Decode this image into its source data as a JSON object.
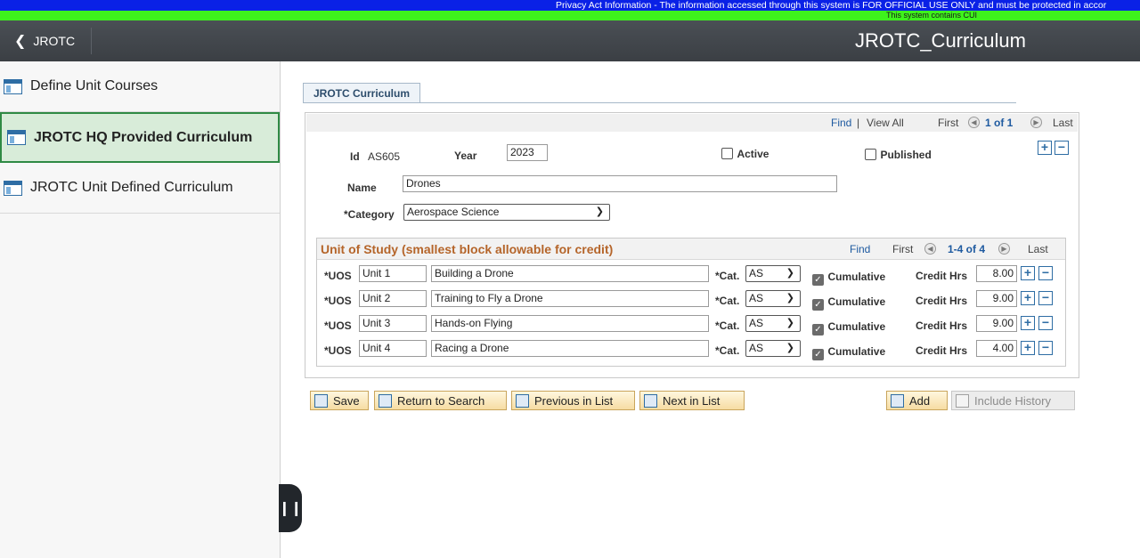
{
  "banners": {
    "privacy": "Privacy Act Information - The information accessed through this system is FOR OFFICIAL USE ONLY and must be protected in accor",
    "cui": "This system contains CUI"
  },
  "header": {
    "back_label": "JROTC",
    "title": "JROTC_Curriculum"
  },
  "sidebar": {
    "items": [
      {
        "label": "Define Unit Courses"
      },
      {
        "label": "JROTC HQ Provided Curriculum"
      },
      {
        "label": "JROTC Unit Defined Curriculum"
      }
    ]
  },
  "tab": {
    "label": "JROTC Curriculum"
  },
  "nav": {
    "find": "Find",
    "sep": "|",
    "view_all": "View All",
    "first": "First",
    "count": "1 of 1",
    "last": "Last"
  },
  "form": {
    "id_label": "Id",
    "id_value": "AS605",
    "year_label": "Year",
    "year_value": "2023",
    "active_label": "Active",
    "published_label": "Published",
    "name_label": "Name",
    "name_value": "Drones",
    "category_label": "*Category",
    "category_value": "Aerospace Science"
  },
  "uos": {
    "title": "Unit of Study (smallest block allowable for credit)",
    "find": "Find",
    "first": "First",
    "count": "1-4 of 4",
    "last": "Last",
    "uos_label": "*UOS",
    "cat_label": "*Cat.",
    "cumulative_label": "Cumulative",
    "credit_label": "Credit Hrs",
    "rows": [
      {
        "unit": "Unit 1",
        "desc": "Building a Drone",
        "cat": "AS",
        "credits": "8.00"
      },
      {
        "unit": "Unit 2",
        "desc": "Training to Fly a Drone",
        "cat": "AS",
        "credits": "9.00"
      },
      {
        "unit": "Unit 3",
        "desc": "Hands-on Flying",
        "cat": "AS",
        "credits": "9.00"
      },
      {
        "unit": "Unit 4",
        "desc": "Racing a Drone",
        "cat": "AS",
        "credits": "4.00"
      }
    ]
  },
  "buttons": {
    "save": "Save",
    "return": "Return to Search",
    "previous": "Previous in List",
    "next": "Next in List",
    "add": "Add",
    "include_history": "Include History"
  },
  "colors": {
    "privacy_banner": "#0a21e6",
    "cui_banner": "#3ef21c",
    "active_nav_bg": "#d8ecd9",
    "active_nav_border": "#2f8a44",
    "section_title": "#b5652a"
  }
}
